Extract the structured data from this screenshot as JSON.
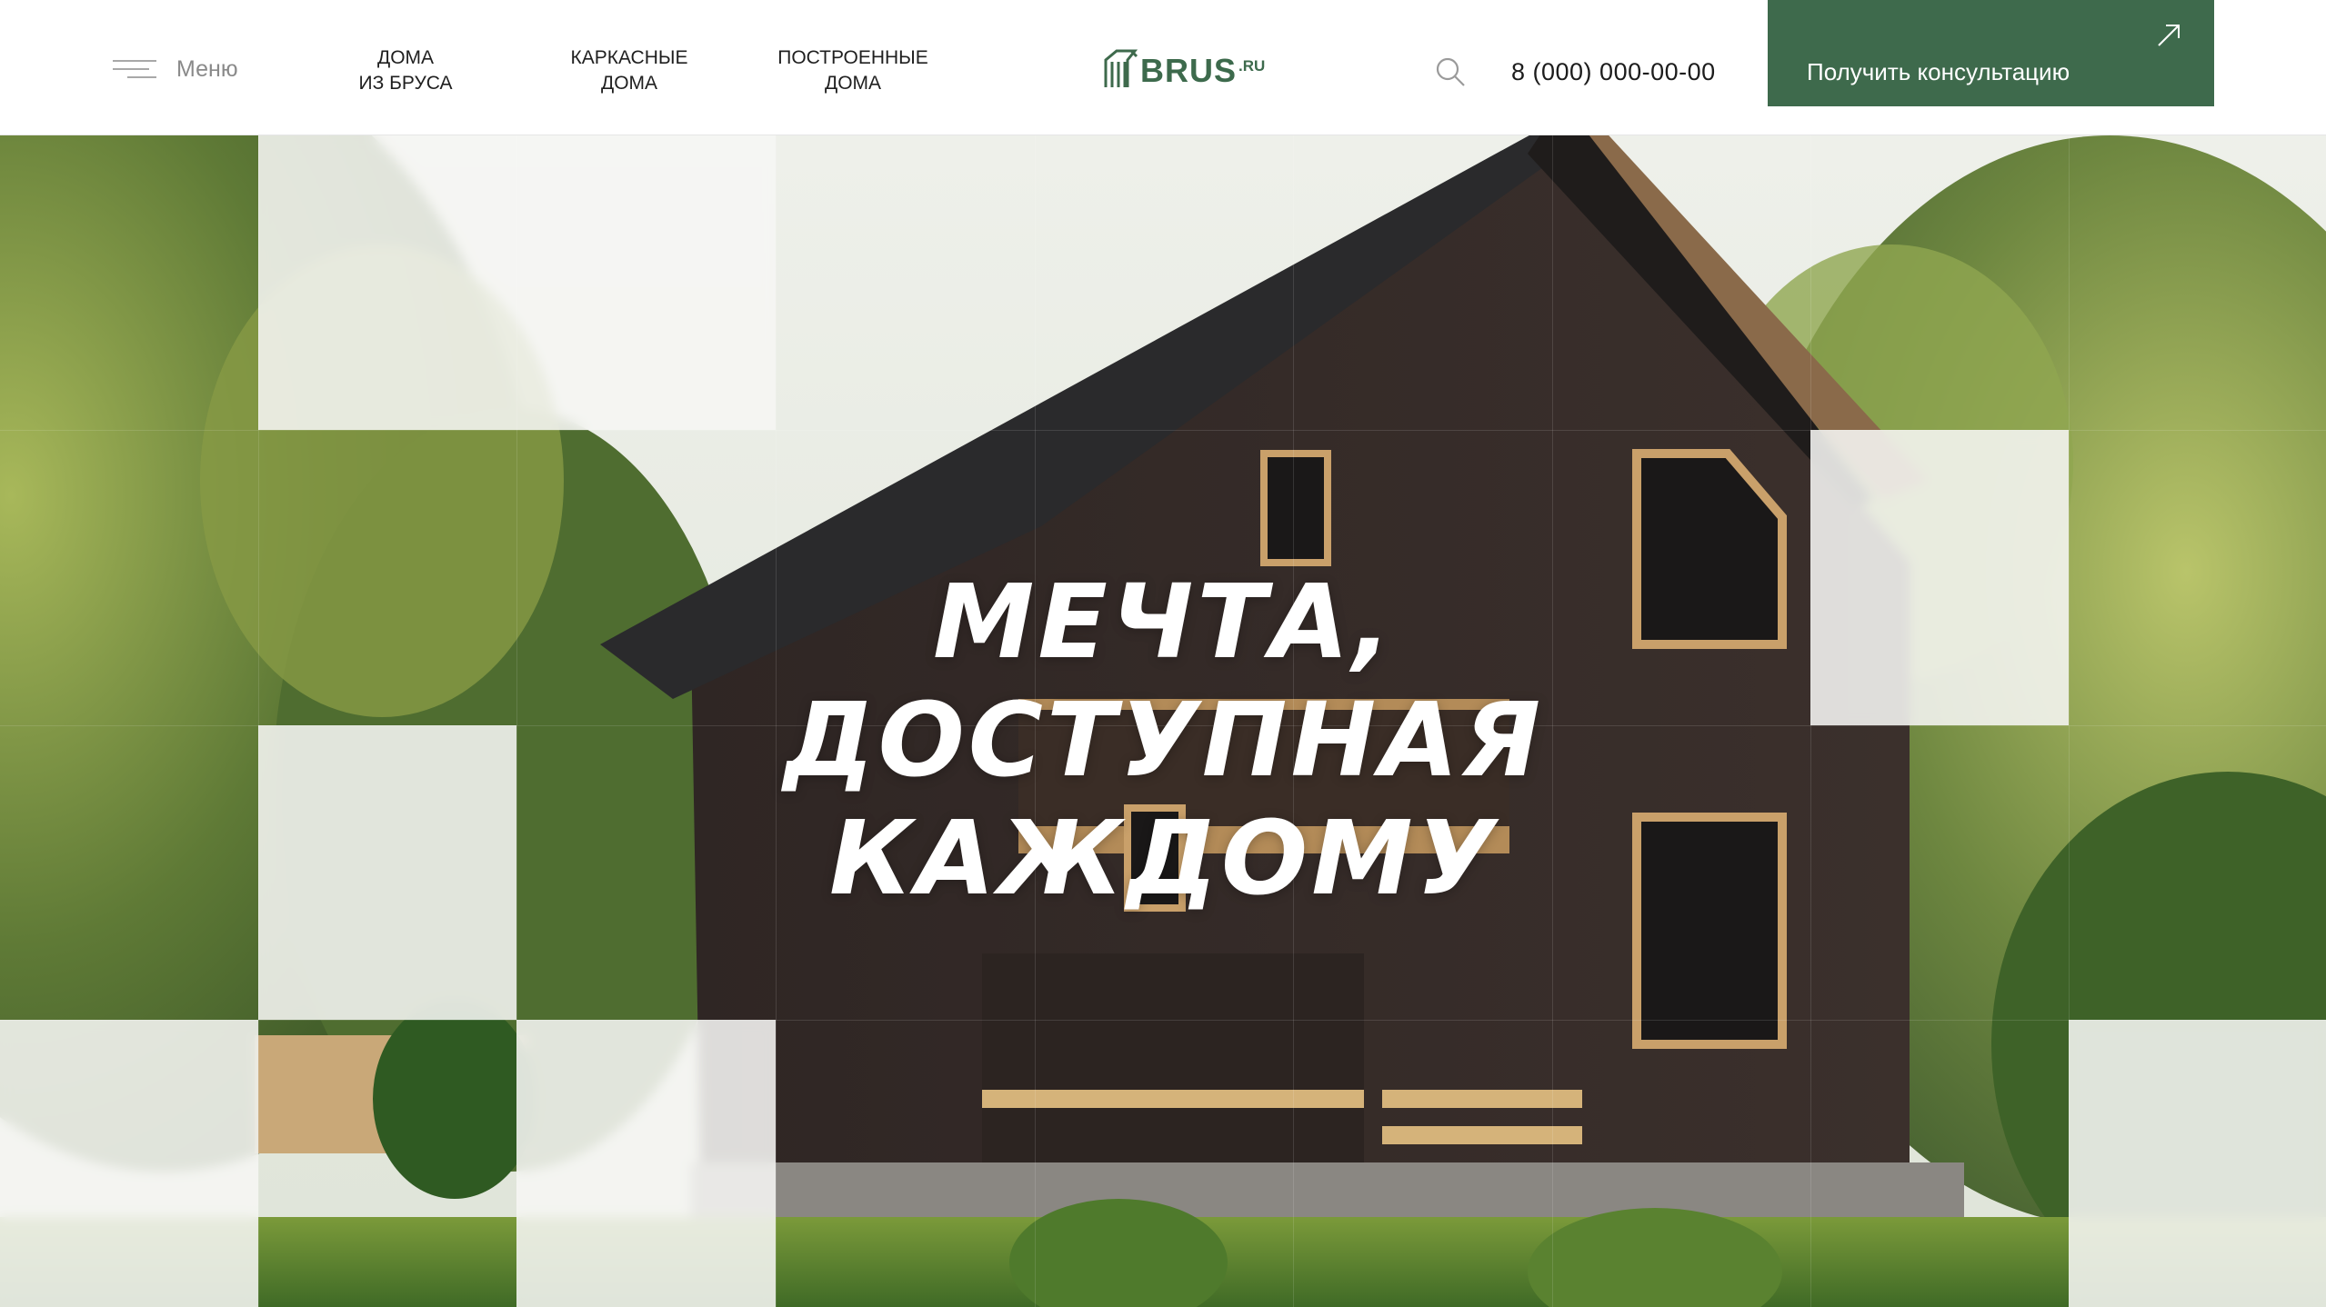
{
  "header": {
    "menu_label": "Меню",
    "nav": [
      {
        "line1": "ДОМА",
        "line2": "ИЗ БРУСА"
      },
      {
        "line1": "КАРКАСНЫЕ",
        "line2": "ДОМА"
      },
      {
        "line1": "ПОСТРОЕННЫЕ",
        "line2": "ДОМА"
      }
    ],
    "logo": {
      "text": "BRUS",
      "suffix": ".RU"
    },
    "phone": "8 (000) 000-00-00",
    "cta_label": "Получить консультацию"
  },
  "hero": {
    "title_lines": [
      "МЕЧТА,",
      "ДОСТУПНАЯ",
      "КАЖДОМУ"
    ]
  },
  "colors": {
    "brand_green": "#3e6a4c",
    "text_dark": "#1f1f1f",
    "muted": "#8a8a8a"
  },
  "icons": [
    "menu-icon",
    "search-icon",
    "arrow-up-right-icon",
    "logo-house-icon"
  ]
}
